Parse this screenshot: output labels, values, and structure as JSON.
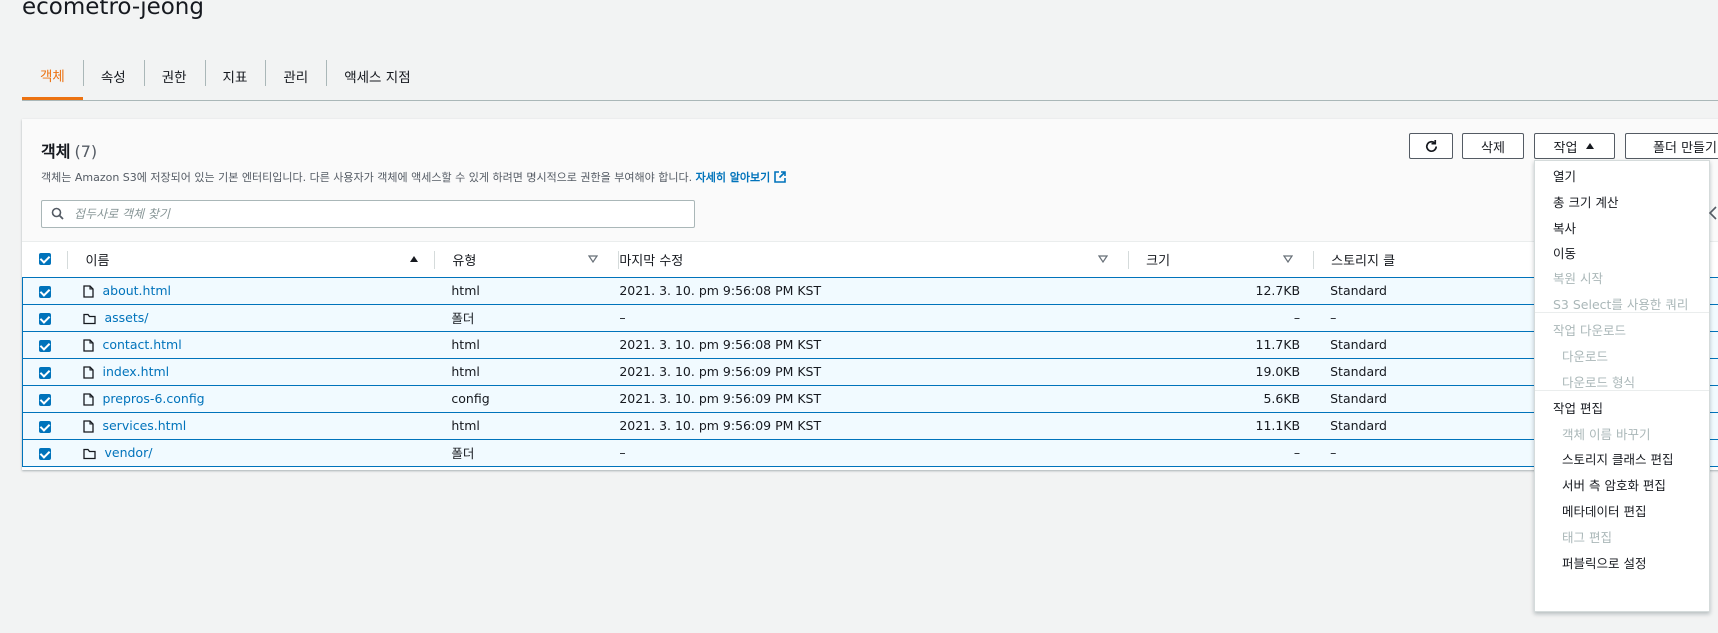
{
  "bucket": {
    "name": "ecometro-jeong"
  },
  "tabs": [
    "객체",
    "속성",
    "권한",
    "지표",
    "관리",
    "액세스 지점"
  ],
  "objects_panel": {
    "title": "객체",
    "count": "(7)",
    "description": "객체는 Amazon S3에 저장되어 있는 기본 엔터티입니다. 다른 사용자가 객체에 액세스할 수 있게 하려면 명시적으로 권한을 부여해야 합니다.",
    "learn_more": "자세히 알아보기",
    "search_placeholder": "접두사로 객체 찾기",
    "buttons": {
      "delete": "삭제",
      "actions": "작업",
      "create_folder": "폴더 만들기"
    },
    "columns": {
      "name": "이름",
      "type": "유형",
      "last_modified": "마지막 수정",
      "size": "크기",
      "storage_class": "스토리지 클"
    },
    "rows": [
      {
        "name": "about.html",
        "kind": "file",
        "type": "html",
        "modified": "2021. 3. 10. pm 9:56:08 PM KST",
        "size": "12.7KB",
        "storage": "Standard"
      },
      {
        "name": "assets/",
        "kind": "folder",
        "type": "폴더",
        "modified": "–",
        "size": "–",
        "storage": "–"
      },
      {
        "name": "contact.html",
        "kind": "file",
        "type": "html",
        "modified": "2021. 3. 10. pm 9:56:08 PM KST",
        "size": "11.7KB",
        "storage": "Standard"
      },
      {
        "name": "index.html",
        "kind": "file",
        "type": "html",
        "modified": "2021. 3. 10. pm 9:56:09 PM KST",
        "size": "19.0KB",
        "storage": "Standard"
      },
      {
        "name": "prepros-6.config",
        "kind": "file",
        "type": "config",
        "modified": "2021. 3. 10. pm 9:56:09 PM KST",
        "size": "5.6KB",
        "storage": "Standard"
      },
      {
        "name": "services.html",
        "kind": "file",
        "type": "html",
        "modified": "2021. 3. 10. pm 9:56:09 PM KST",
        "size": "11.1KB",
        "storage": "Standard"
      },
      {
        "name": "vendor/",
        "kind": "folder",
        "type": "폴더",
        "modified": "–",
        "size": "–",
        "storage": "–"
      }
    ]
  },
  "actions_menu": [
    {
      "label": "열기",
      "enabled": true,
      "sub": false
    },
    {
      "label": "총 크기 계산",
      "enabled": true,
      "sub": false
    },
    {
      "label": "복사",
      "enabled": true,
      "sub": false
    },
    {
      "label": "이동",
      "enabled": true,
      "sub": false
    },
    {
      "label": "복원 시작",
      "enabled": false,
      "sub": false
    },
    {
      "label": "S3 Select를 사용한 쿼리",
      "enabled": false,
      "sub": false
    },
    {
      "label": "작업 다운로드",
      "enabled": false,
      "sub": false,
      "divider_before": true
    },
    {
      "label": "다운로드",
      "enabled": false,
      "sub": true
    },
    {
      "label": "다운로드 형식",
      "enabled": false,
      "sub": true
    },
    {
      "label": "작업 편집",
      "enabled": true,
      "sub": false,
      "divider_before": true
    },
    {
      "label": "객체 이름 바꾸기",
      "enabled": false,
      "sub": true
    },
    {
      "label": "스토리지 클래스 편집",
      "enabled": true,
      "sub": true
    },
    {
      "label": "서버 측 암호화 편집",
      "enabled": true,
      "sub": true
    },
    {
      "label": "메타데이터 편집",
      "enabled": true,
      "sub": true
    },
    {
      "label": "태그 편집",
      "enabled": false,
      "sub": true
    },
    {
      "label": "퍼블릭으로 설정",
      "enabled": true,
      "sub": true
    }
  ]
}
